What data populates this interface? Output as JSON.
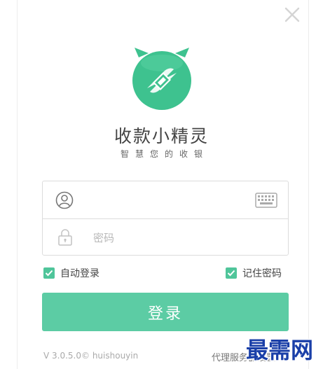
{
  "app": {
    "name": "收款小精灵",
    "slogan": "智慧您的收银",
    "brand_color": "#3ec28f",
    "accent_color": "#5ccca4"
  },
  "window": {
    "close_icon": "close-icon"
  },
  "login_form": {
    "username_value": "",
    "username_icon": "user-icon",
    "keyboard_icon": "keyboard-icon",
    "password_placeholder": "密码",
    "password_icon": "lock-icon"
  },
  "options": {
    "auto_login_label": "自动登录",
    "auto_login_checked": true,
    "remember_password_label": "记住密码",
    "remember_password_checked": true
  },
  "login_button_label": "登录",
  "footer": {
    "version": "V 3.0.5.0© huishouyin",
    "proxy_link": "代理服务器设置"
  },
  "watermark": {
    "text": "最需网",
    "color": "#1a3fa8"
  }
}
